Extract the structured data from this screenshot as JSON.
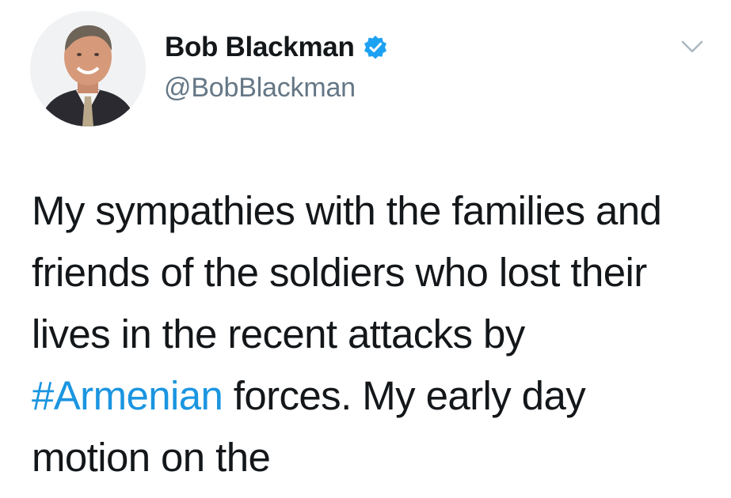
{
  "author": {
    "display_name": "Bob Blackman",
    "handle": "@BobBlackman",
    "verified": true
  },
  "icons": {
    "verified": "verified-badge-icon",
    "more": "chevron-down-icon"
  },
  "tweet": {
    "text_before": "My sympathies with the families and friends of the soldiers who lost their lives in the recent attacks by ",
    "hashtag": "#Armenian",
    "text_after": " forces. My early day motion on the"
  },
  "colors": {
    "hashtag": "#1b95e0",
    "verified": "#1da1f2",
    "handle": "#657786",
    "text": "#14171a"
  }
}
